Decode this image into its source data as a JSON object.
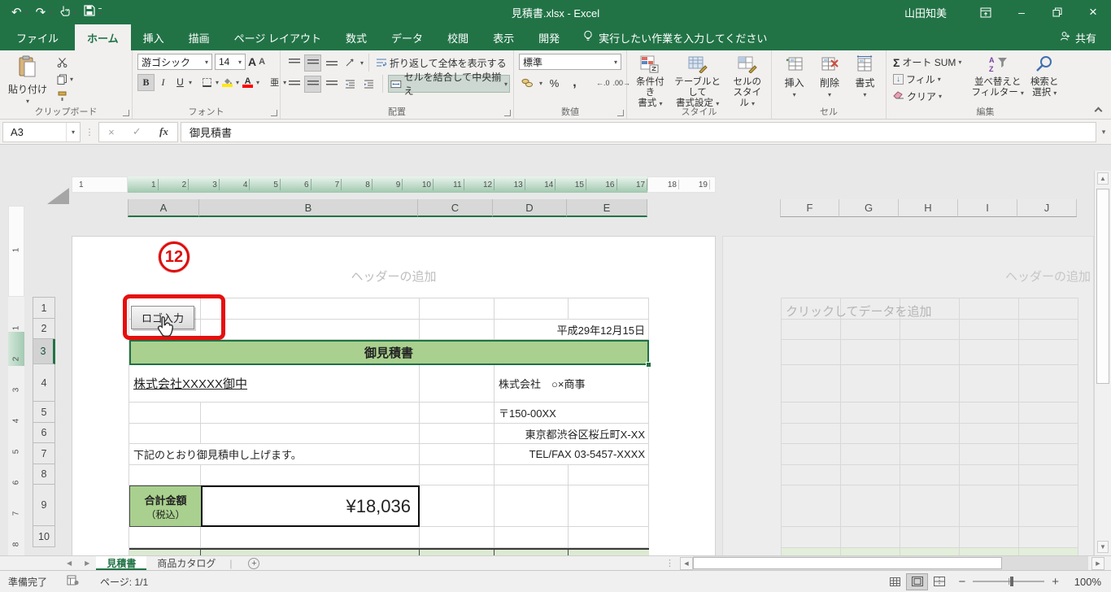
{
  "title_bar": {
    "title": "見積書.xlsx - Excel",
    "user": "山田知美"
  },
  "ribbon_tabs": [
    {
      "label": "ファイル"
    },
    {
      "label": "ホーム"
    },
    {
      "label": "挿入"
    },
    {
      "label": "描画"
    },
    {
      "label": "ページ レイアウト"
    },
    {
      "label": "数式"
    },
    {
      "label": "データ"
    },
    {
      "label": "校閲"
    },
    {
      "label": "表示"
    },
    {
      "label": "開発"
    }
  ],
  "tell_me": "実行したい作業を入力してください",
  "share_label": "共有",
  "ribbon": {
    "clipboard": {
      "label": "クリップボード",
      "paste": "貼り付け"
    },
    "font": {
      "label": "フォント",
      "name": "游ゴシック",
      "size": "14"
    },
    "alignment": {
      "label": "配置",
      "wrap": "折り返して全体を表示する",
      "merge": "セルを結合して中央揃え"
    },
    "number": {
      "label": "数値",
      "format": "標準"
    },
    "styles": {
      "label": "スタイル",
      "conditional1": "条件付き",
      "conditional2": "書式",
      "table1": "テーブルとして",
      "table2": "書式設定",
      "cellstyle1": "セルの",
      "cellstyle2": "スタイル"
    },
    "cells": {
      "label": "セル",
      "insert": "挿入",
      "delete": "削除",
      "format": "書式"
    },
    "editing": {
      "label": "編集",
      "autosum": "オート SUM",
      "fill": "フィル",
      "clear": "クリア",
      "sort1": "並べ替えと",
      "sort2": "フィルター",
      "find1": "検索と",
      "find2": "選択"
    }
  },
  "formula_bar": {
    "name_box": "A3",
    "fx": "fx",
    "value": "御見積書"
  },
  "ruler_h": {
    "left": "1",
    "nums": [
      "1",
      "2",
      "3",
      "4",
      "5",
      "6",
      "7",
      "8",
      "9",
      "10",
      "11",
      "12",
      "13",
      "14",
      "15",
      "16",
      "17"
    ],
    "right": [
      "18",
      "19"
    ]
  },
  "ruler_v": {
    "top": "1",
    "nums": [
      "1",
      "2",
      "3",
      "4",
      "5",
      "6",
      "7",
      "8"
    ]
  },
  "columns_p1": [
    "A",
    "B",
    "C",
    "D",
    "E"
  ],
  "columns_p2": [
    "F",
    "G",
    "H",
    "I",
    "J"
  ],
  "row_nums": [
    "1",
    "2",
    "3",
    "4",
    "5",
    "6",
    "7",
    "8",
    "9",
    "10"
  ],
  "page1": {
    "header_placeholder": "ヘッダーの追加",
    "callout": "12",
    "logo_button": "ロゴ入力",
    "date": "平成29年12月15日",
    "title": "御見積書",
    "recipient": "株式会社XXXXX御中",
    "supplier": "株式会社　○×商事",
    "postal": "〒150-00XX",
    "address": "東京都渋谷区桜丘町X-XX",
    "tel": "TEL/FAX 03-5457-XXXX",
    "message": "下記のとおり御見積申し上げます。",
    "total_label": "合計金額",
    "total_sub": "（税込）",
    "total_value": "¥18,036"
  },
  "page2": {
    "header_placeholder": "ヘッダーの追加",
    "data_placeholder": "クリックしてデータを追加"
  },
  "sheet_tabs": [
    {
      "label": "見積書"
    },
    {
      "label": "商品カタログ"
    }
  ],
  "status_bar": {
    "ready": "準備完了",
    "page": "ページ: 1/1",
    "zoom": "100%"
  },
  "icons": {
    "caret": "▾",
    "undo": "↶",
    "redo": "↷",
    "check": "✓",
    "cancel": "×",
    "close": "×",
    "minimize": "–",
    "dots": "⋮",
    "sigma": "Σ",
    "percent": "%",
    "comma": ",",
    "minus": "−",
    "plus": "+",
    "bold": "B",
    "italic": "I",
    "underline": "U",
    "phonetic": "亜",
    "grow": "A",
    "shrink": "A",
    "left_arrow": "◀",
    "right_arrow": "▶",
    "up_arrow": "▲",
    "down_arrow": "▼",
    "fill_down": "↓",
    "dec_inc": "←.0",
    "dec_dec": ".00→",
    "add": "+"
  }
}
